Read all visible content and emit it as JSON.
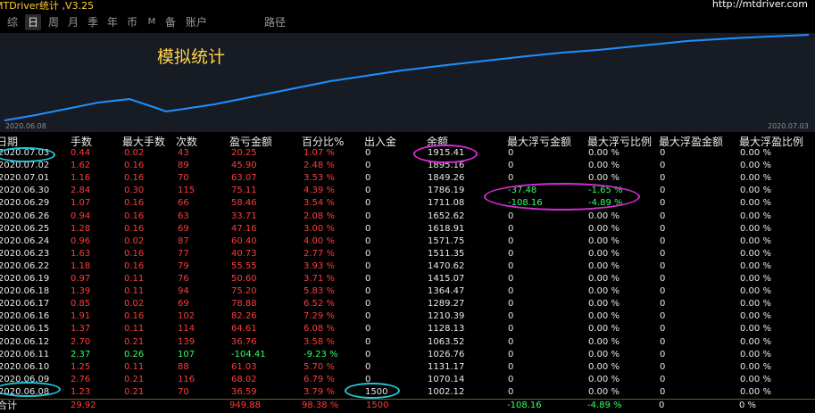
{
  "app": {
    "title": "MTDriver统计 ,V3.25",
    "url": "http://mtdriver.com"
  },
  "tabs": [
    "综",
    "日",
    "周",
    "月",
    "季",
    "年",
    "币",
    "M",
    "备",
    "账户",
    "路径"
  ],
  "chart": {
    "title": "模拟统计",
    "start_date": "2020.06.08",
    "end_date": "2020.07.03",
    "line_color": "#1e90ff"
  },
  "headers": [
    "日期",
    "手数",
    "最大手数",
    "次数",
    "盈亏金额",
    "百分比%",
    "出入金",
    "余额",
    "最大浮亏金额",
    "最大浮亏比例",
    "最大浮盈金额",
    "最大浮盈比例"
  ],
  "rows": [
    {
      "date": "2020.07.03",
      "lots": "0.44",
      "max_lots": "0.02",
      "count": "43",
      "pl": "20.25",
      "pct": "1.07 %",
      "flow": "0",
      "balance": "1915.41",
      "max_dd": "0",
      "max_dd_pct": "0.00 %",
      "max_gain": "0",
      "max_gain_pct": "0.00 %",
      "neg": false
    },
    {
      "date": "2020.07.02",
      "lots": "1.62",
      "max_lots": "0.16",
      "count": "89",
      "pl": "45.90",
      "pct": "2.48 %",
      "flow": "0",
      "balance": "1895.16",
      "max_dd": "0",
      "max_dd_pct": "0.00 %",
      "max_gain": "0",
      "max_gain_pct": "0.00 %",
      "neg": false
    },
    {
      "date": "2020.07.01",
      "lots": "1.16",
      "max_lots": "0.16",
      "count": "70",
      "pl": "63.07",
      "pct": "3.53 %",
      "flow": "0",
      "balance": "1849.26",
      "max_dd": "0",
      "max_dd_pct": "0.00 %",
      "max_gain": "0",
      "max_gain_pct": "0.00 %",
      "neg": false
    },
    {
      "date": "2020.06.30",
      "lots": "2.84",
      "max_lots": "0.30",
      "count": "115",
      "pl": "75.11",
      "pct": "4.39 %",
      "flow": "0",
      "balance": "1786.19",
      "max_dd": "-37.48",
      "max_dd_pct": "-1.65 %",
      "max_gain": "0",
      "max_gain_pct": "0.00 %",
      "neg": false
    },
    {
      "date": "2020.06.29",
      "lots": "1.07",
      "max_lots": "0.16",
      "count": "66",
      "pl": "58.46",
      "pct": "3.54 %",
      "flow": "0",
      "balance": "1711.08",
      "max_dd": "-108.16",
      "max_dd_pct": "-4.89 %",
      "max_gain": "0",
      "max_gain_pct": "0.00 %",
      "neg": false
    },
    {
      "date": "2020.06.26",
      "lots": "0.94",
      "max_lots": "0.16",
      "count": "63",
      "pl": "33.71",
      "pct": "2.08 %",
      "flow": "0",
      "balance": "1652.62",
      "max_dd": "0",
      "max_dd_pct": "0.00 %",
      "max_gain": "0",
      "max_gain_pct": "0.00 %",
      "neg": false
    },
    {
      "date": "2020.06.25",
      "lots": "1.28",
      "max_lots": "0.16",
      "count": "69",
      "pl": "47.16",
      "pct": "3.00 %",
      "flow": "0",
      "balance": "1618.91",
      "max_dd": "0",
      "max_dd_pct": "0.00 %",
      "max_gain": "0",
      "max_gain_pct": "0.00 %",
      "neg": false
    },
    {
      "date": "2020.06.24",
      "lots": "0.96",
      "max_lots": "0.02",
      "count": "87",
      "pl": "60.40",
      "pct": "4.00 %",
      "flow": "0",
      "balance": "1571.75",
      "max_dd": "0",
      "max_dd_pct": "0.00 %",
      "max_gain": "0",
      "max_gain_pct": "0.00 %",
      "neg": false
    },
    {
      "date": "2020.06.23",
      "lots": "1.63",
      "max_lots": "0.16",
      "count": "77",
      "pl": "40.73",
      "pct": "2.77 %",
      "flow": "0",
      "balance": "1511.35",
      "max_dd": "0",
      "max_dd_pct": "0.00 %",
      "max_gain": "0",
      "max_gain_pct": "0.00 %",
      "neg": false
    },
    {
      "date": "2020.06.22",
      "lots": "1.18",
      "max_lots": "0.16",
      "count": "79",
      "pl": "55.55",
      "pct": "3.93 %",
      "flow": "0",
      "balance": "1470.62",
      "max_dd": "0",
      "max_dd_pct": "0.00 %",
      "max_gain": "0",
      "max_gain_pct": "0.00 %",
      "neg": false
    },
    {
      "date": "2020.06.19",
      "lots": "0.97",
      "max_lots": "0.11",
      "count": "76",
      "pl": "50.60",
      "pct": "3.71 %",
      "flow": "0",
      "balance": "1415.07",
      "max_dd": "0",
      "max_dd_pct": "0.00 %",
      "max_gain": "0",
      "max_gain_pct": "0.00 %",
      "neg": false
    },
    {
      "date": "2020.06.18",
      "lots": "1.39",
      "max_lots": "0.11",
      "count": "94",
      "pl": "75.20",
      "pct": "5.83 %",
      "flow": "0",
      "balance": "1364.47",
      "max_dd": "0",
      "max_dd_pct": "0.00 %",
      "max_gain": "0",
      "max_gain_pct": "0.00 %",
      "neg": false
    },
    {
      "date": "2020.06.17",
      "lots": "0.85",
      "max_lots": "0.02",
      "count": "69",
      "pl": "78.88",
      "pct": "6.52 %",
      "flow": "0",
      "balance": "1289.27",
      "max_dd": "0",
      "max_dd_pct": "0.00 %",
      "max_gain": "0",
      "max_gain_pct": "0.00 %",
      "neg": false
    },
    {
      "date": "2020.06.16",
      "lots": "1.91",
      "max_lots": "0.16",
      "count": "102",
      "pl": "82.26",
      "pct": "7.29 %",
      "flow": "0",
      "balance": "1210.39",
      "max_dd": "0",
      "max_dd_pct": "0.00 %",
      "max_gain": "0",
      "max_gain_pct": "0.00 %",
      "neg": false
    },
    {
      "date": "2020.06.15",
      "lots": "1.37",
      "max_lots": "0.11",
      "count": "114",
      "pl": "64.61",
      "pct": "6.08 %",
      "flow": "0",
      "balance": "1128.13",
      "max_dd": "0",
      "max_dd_pct": "0.00 %",
      "max_gain": "0",
      "max_gain_pct": "0.00 %",
      "neg": false
    },
    {
      "date": "2020.06.12",
      "lots": "2.70",
      "max_lots": "0.21",
      "count": "139",
      "pl": "36.76",
      "pct": "3.58 %",
      "flow": "0",
      "balance": "1063.52",
      "max_dd": "0",
      "max_dd_pct": "0.00 %",
      "max_gain": "0",
      "max_gain_pct": "0.00 %",
      "neg": false
    },
    {
      "date": "2020.06.11",
      "lots": "2.37",
      "max_lots": "0.26",
      "count": "107",
      "pl": "-104.41",
      "pct": "-9.23 %",
      "flow": "0",
      "balance": "1026.76",
      "max_dd": "0",
      "max_dd_pct": "0.00 %",
      "max_gain": "0",
      "max_gain_pct": "0.00 %",
      "neg": true
    },
    {
      "date": "2020.06.10",
      "lots": "1.25",
      "max_lots": "0.11",
      "count": "88",
      "pl": "61.03",
      "pct": "5.70 %",
      "flow": "0",
      "balance": "1131.17",
      "max_dd": "0",
      "max_dd_pct": "0.00 %",
      "max_gain": "0",
      "max_gain_pct": "0.00 %",
      "neg": false
    },
    {
      "date": "2020.06.09",
      "lots": "2.76",
      "max_lots": "0.21",
      "count": "116",
      "pl": "68.02",
      "pct": "6.79 %",
      "flow": "0",
      "balance": "1070.14",
      "max_dd": "0",
      "max_dd_pct": "0.00 %",
      "max_gain": "0",
      "max_gain_pct": "0.00 %",
      "neg": false
    },
    {
      "date": "2020.06.08",
      "lots": "1.23",
      "max_lots": "0.21",
      "count": "70",
      "pl": "36.59",
      "pct": "3.79 %",
      "flow": "1500",
      "balance": "1002.12",
      "max_dd": "0",
      "max_dd_pct": "0.00 %",
      "max_gain": "0",
      "max_gain_pct": "0.00 %",
      "neg": false
    }
  ],
  "total": {
    "label": "合计",
    "lots": "29.92",
    "pl": "949.88",
    "pct": "98.38 %",
    "flow": "1500",
    "max_dd": "-108.16",
    "max_dd_pct": "-4.89 %",
    "max_gain": "0",
    "max_gain_pct": "0 %"
  }
}
